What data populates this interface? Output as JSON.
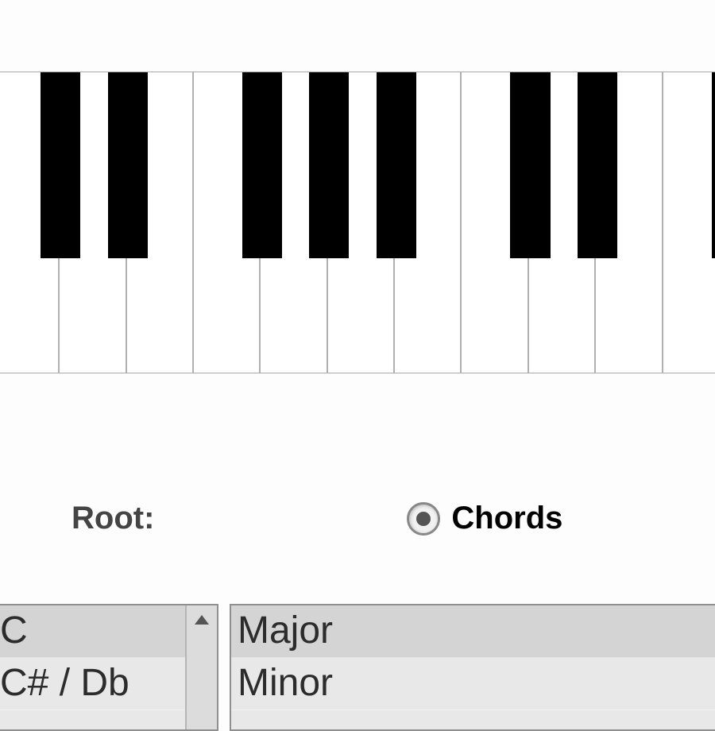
{
  "piano": {
    "white_keys": 11,
    "black_key_offsets_pct": [
      6.5,
      15.6,
      33.8,
      42.9,
      52.0,
      70.2,
      79.3,
      97.5
    ],
    "white_key_width_pct": 9.09,
    "black_key_width_pct": 5.4
  },
  "controls": {
    "root_label": "Root:",
    "mode_radio": {
      "selected_label": "Chords",
      "selected": true
    }
  },
  "root_listbox": {
    "items": [
      "C",
      "C# / Db"
    ],
    "selected_index": 0
  },
  "chord_listbox": {
    "items": [
      "Major",
      "Minor"
    ],
    "selected_index": 0
  }
}
